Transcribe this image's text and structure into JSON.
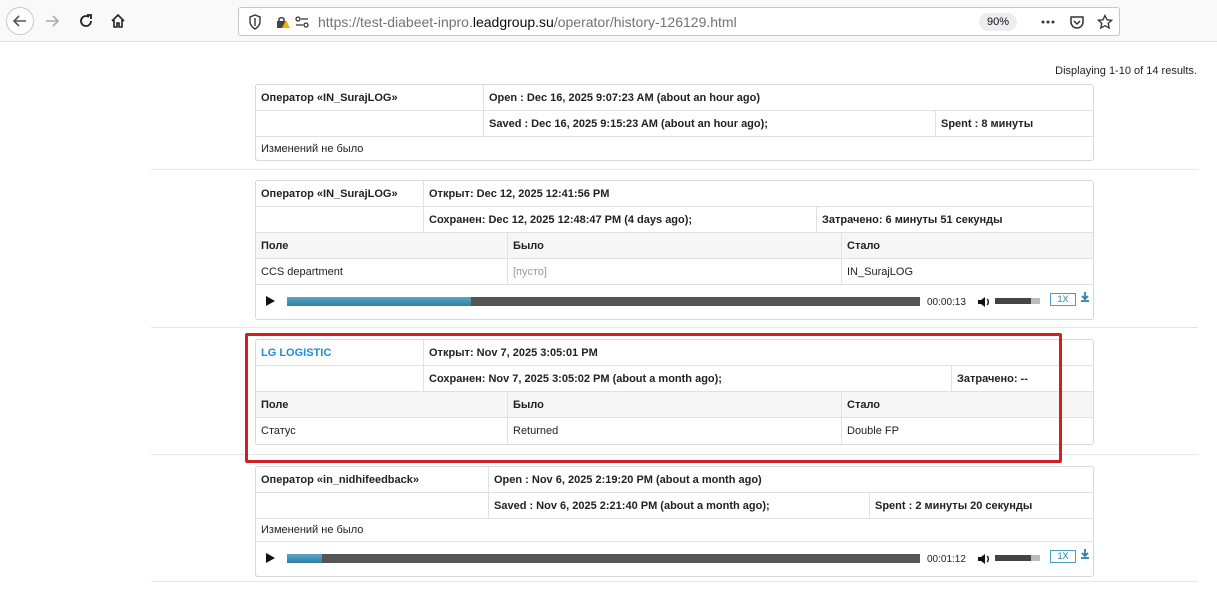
{
  "browser": {
    "url_prefix": "https://test-diabeet-inpro.",
    "url_domain": "leadgroup.su",
    "url_path": "/operator/history-126129.html",
    "zoom": "90%"
  },
  "display_count": "Displaying 1-10 of 14 results.",
  "entries": [
    {
      "operator": "Оператор «IN_SurajLOG»",
      "open": "Open : Dec 16, 2025 9:07:23 AM (about an hour ago)",
      "saved": "Saved : Dec 16, 2025 9:15:23 AM (about an hour ago);",
      "spent": "Spent : 8 минуты",
      "note": "Изменений не было"
    },
    {
      "operator": "Оператор «IN_SurajLOG»",
      "open": "Открыт: Dec 12, 2025 12:41:56 PM",
      "saved": "Сохранен: Dec 12, 2025 12:48:47 PM (4 days ago);",
      "spent": "Затрачено: 6 минуты 51 секунды",
      "headers": {
        "field": "Поле",
        "was": "Было",
        "became": "Стало"
      },
      "change": {
        "field": "CCS department",
        "was": "[пусто]",
        "became": "IN_SurajLOG"
      },
      "audio": {
        "time": "00:00:13",
        "progress": 0.29,
        "volume": 0.8,
        "rate": "1X"
      }
    },
    {
      "operator": "LG LOGISTIC",
      "open": "Открыт: Nov 7, 2025 3:05:01 PM",
      "saved": "Сохранен: Nov 7, 2025 3:05:02 PM (about a month ago);",
      "spent": "Затрачено: --",
      "headers": {
        "field": "Поле",
        "was": "Было",
        "became": "Стало"
      },
      "change": {
        "field": "Статус",
        "was": "Returned",
        "became": "Double FP"
      }
    },
    {
      "operator": "Оператор «in_nidhifeedback»",
      "open": "Open : Nov 6, 2025 2:19:20 PM (about a month ago)",
      "saved": "Saved : Nov 6, 2025 2:21:40 PM (about a month ago);",
      "spent": "Spent : 2 минуты 20 секунды",
      "note": "Изменений не было",
      "audio": {
        "time": "00:01:12",
        "progress": 0.055,
        "volume": 0.8,
        "rate": "1X"
      }
    }
  ]
}
